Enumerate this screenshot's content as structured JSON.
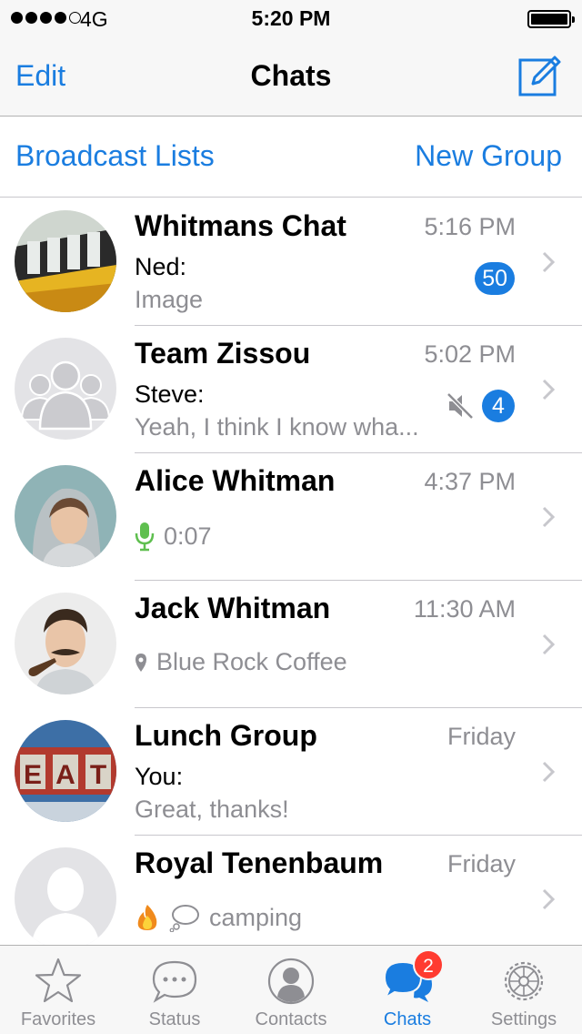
{
  "status_bar": {
    "carrier": "4G",
    "time": "5:20 PM"
  },
  "nav": {
    "edit_label": "Edit",
    "title": "Chats"
  },
  "actions": {
    "broadcast_label": "Broadcast Lists",
    "new_group_label": "New Group"
  },
  "chats": [
    {
      "name": "Whitmans Chat",
      "time": "5:16 PM",
      "sender": "Ned:",
      "preview": "Image",
      "unread": "50"
    },
    {
      "name": "Team Zissou",
      "time": "5:02 PM",
      "sender": "Steve:",
      "preview": "Yeah, I think I know wha...",
      "unread": "4",
      "muted": true
    },
    {
      "name": "Alice Whitman",
      "time": "4:37 PM",
      "voice_duration": "0:07"
    },
    {
      "name": "Jack Whitman",
      "time": "11:30 AM",
      "location": "Blue Rock Coffee"
    },
    {
      "name": "Lunch Group",
      "time": "Friday",
      "sender": "You:",
      "preview": "Great, thanks!"
    },
    {
      "name": "Royal Tenenbaum",
      "time": "Friday",
      "preview": "camping",
      "emoji": [
        "fire-emoji",
        "thought-bubble-emoji"
      ]
    }
  ],
  "tabs": [
    {
      "label": "Favorites",
      "icon": "star-icon"
    },
    {
      "label": "Status",
      "icon": "speech-bubble-icon"
    },
    {
      "label": "Contacts",
      "icon": "person-icon"
    },
    {
      "label": "Chats",
      "icon": "chats-icon",
      "badge": "2",
      "active": true
    },
    {
      "label": "Settings",
      "icon": "gear-icon"
    }
  ],
  "colors": {
    "accent": "#1a7de0",
    "badge_red": "#ff3b30",
    "secondary_text": "#8e8e93",
    "mic_green": "#5fbf4f"
  }
}
